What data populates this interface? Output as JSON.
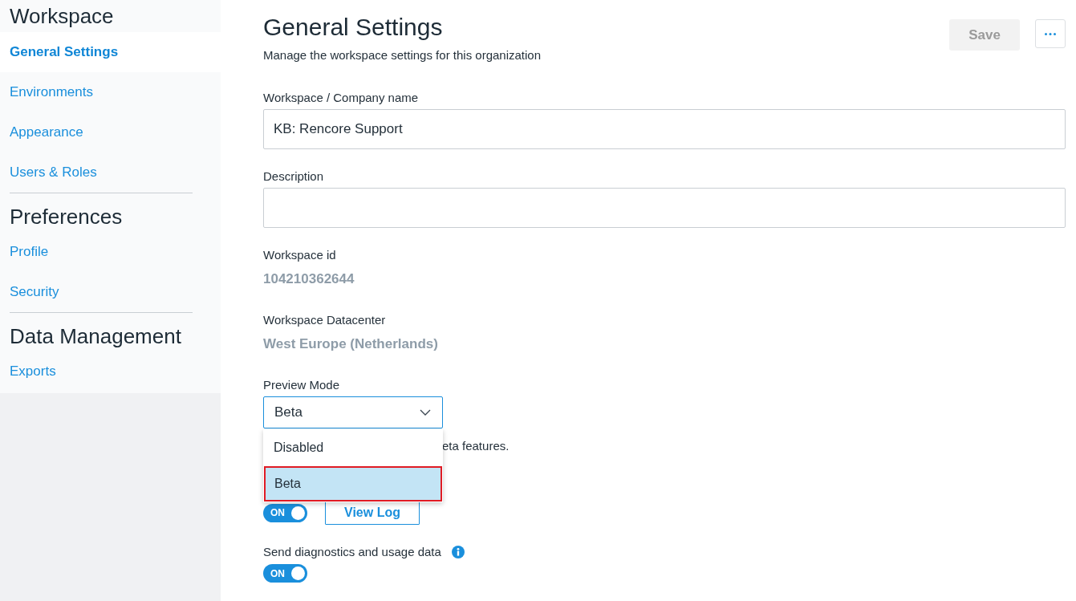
{
  "sidebar": {
    "sections": [
      {
        "title": "Workspace",
        "items": [
          {
            "label": "General Settings",
            "selected": true
          },
          {
            "label": "Environments",
            "selected": false
          },
          {
            "label": "Appearance",
            "selected": false
          },
          {
            "label": "Users & Roles",
            "selected": false
          }
        ]
      },
      {
        "title": "Preferences",
        "items": [
          {
            "label": "Profile",
            "selected": false
          },
          {
            "label": "Security",
            "selected": false
          }
        ]
      },
      {
        "title": "Data Management",
        "items": [
          {
            "label": "Exports",
            "selected": false
          }
        ]
      }
    ]
  },
  "header": {
    "title": "General Settings",
    "subtitle": "Manage the workspace settings for this organization",
    "buttons": [
      {
        "kind": "save",
        "label": "Save",
        "disabled": true
      },
      {
        "kind": "more"
      }
    ]
  },
  "fields": [
    {
      "kind": "text",
      "label": "Workspace / Company name",
      "value": "KB: Rencore Support"
    },
    {
      "kind": "text",
      "label": "Description"
    },
    {
      "kind": "readonly",
      "label": "Workspace id",
      "value": "104210362644"
    },
    {
      "kind": "readonly",
      "label": "Workspace Datacenter",
      "value": "West Europe (Netherlands)"
    },
    {
      "kind": "select",
      "label": "Preview Mode",
      "value": "Beta",
      "expanded": true,
      "options": [
        {
          "label": "Disabled",
          "selected": false
        },
        {
          "label": "Beta",
          "selected": true
        }
      ],
      "hint": "eta features."
    },
    {
      "kind": "toggle",
      "on": true,
      "state_label": "ON",
      "button": "View Log"
    },
    {
      "kind": "toggle",
      "label": "Send diagnostics and usage data",
      "info": true,
      "on": true,
      "state_label": "ON"
    }
  ]
}
